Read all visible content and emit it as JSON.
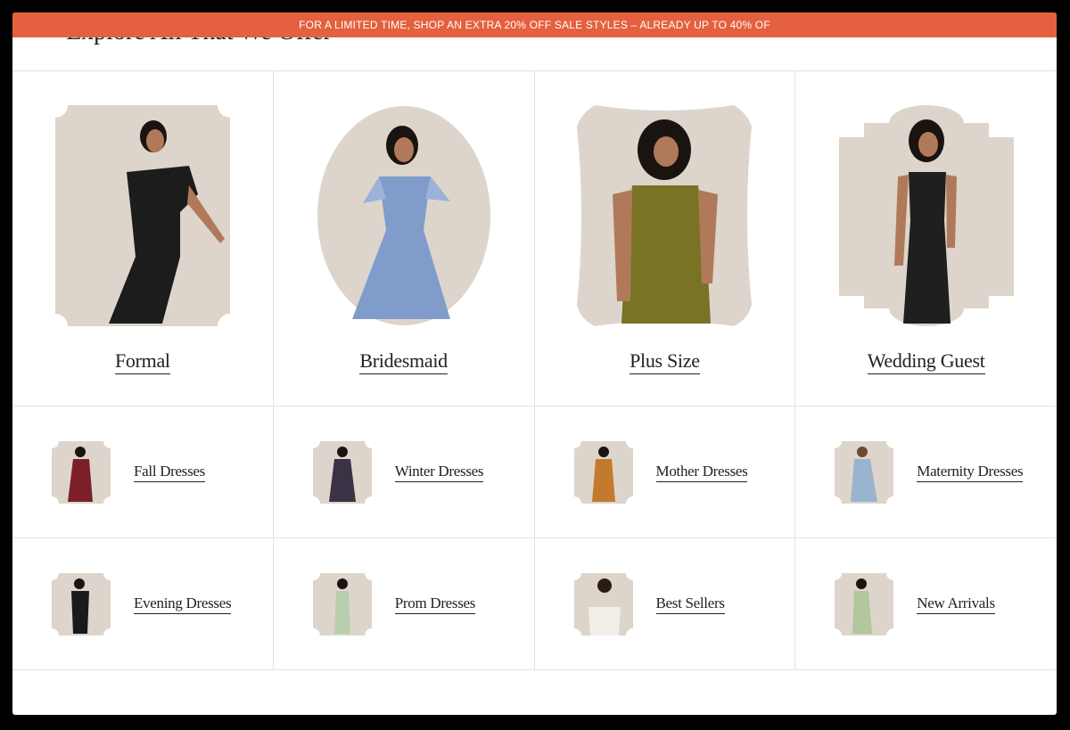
{
  "promo_banner": {
    "text": "FOR A LIMITED TIME, SHOP AN EXTRA 20% OFF SALE STYLES – ALREADY UP TO 40% OF"
  },
  "section_heading": {
    "text": "Explore All That We Offer"
  },
  "featured_categories": [
    {
      "label": "Formal",
      "dress_color": "#1c1c1c"
    },
    {
      "label": "Bridesmaid",
      "dress_color": "#7f9ccb"
    },
    {
      "label": "Plus Size",
      "dress_color": "#7a7326"
    },
    {
      "label": "Wedding Guest",
      "dress_color": "#1f1f1f"
    }
  ],
  "sub_categories_row1": [
    {
      "label": "Fall Dresses",
      "dress_color": "#7d1f2a"
    },
    {
      "label": "Winter Dresses",
      "dress_color": "#3a3346"
    },
    {
      "label": "Mother Dresses",
      "dress_color": "#c47a2e"
    },
    {
      "label": "Maternity Dresses",
      "dress_color": "#9ab3cf"
    }
  ],
  "sub_categories_row2": [
    {
      "label": "Evening Dresses",
      "dress_color": "#1a1a1a"
    },
    {
      "label": "Prom Dresses",
      "dress_color": "#b8cfae"
    },
    {
      "label": "Best Sellers",
      "dress_color": "#f2efe9"
    },
    {
      "label": "New Arrivals",
      "dress_color": "#b2c79b"
    }
  ],
  "colors": {
    "promo_bg": "#e4603e",
    "card_bg": "#ddd5cb",
    "skin": "#b07a5a",
    "hair": "#1a1411"
  }
}
